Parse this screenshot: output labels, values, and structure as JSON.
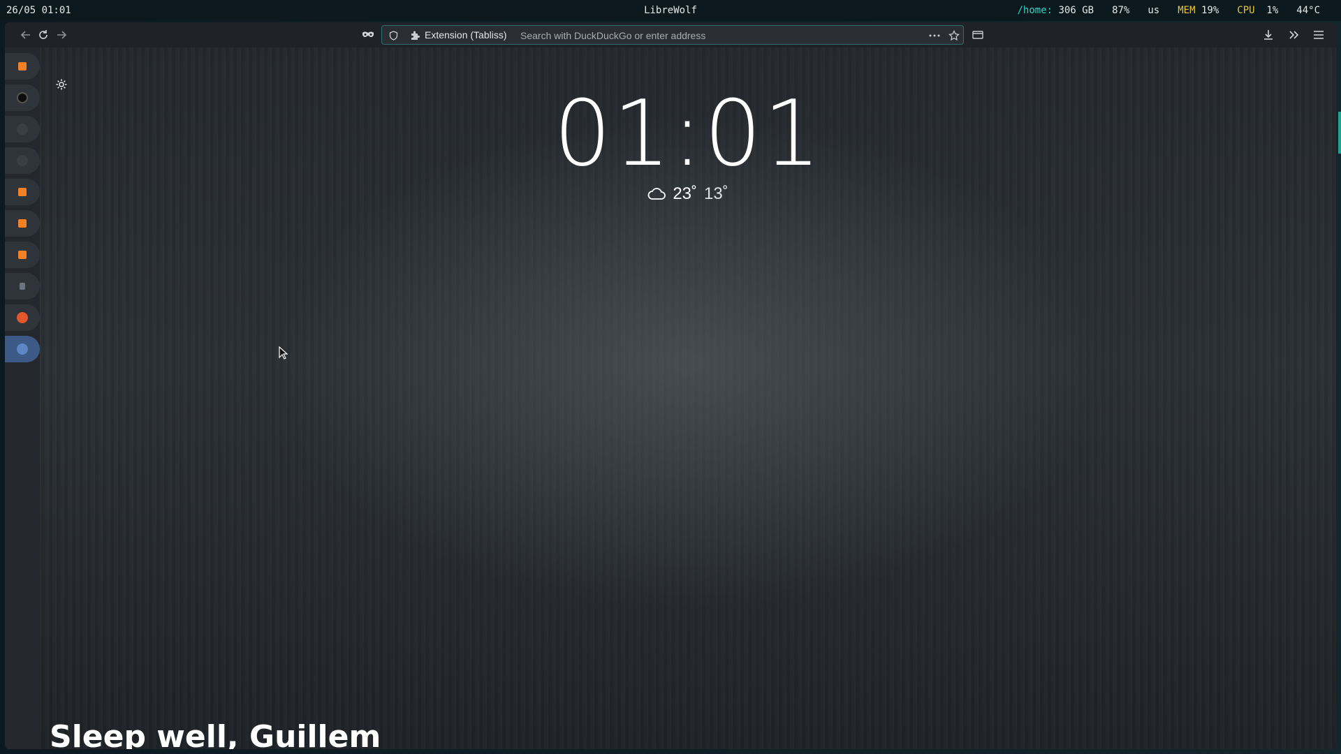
{
  "statusbar": {
    "datetime": "26/05 01:01",
    "window_title": "LibreWolf",
    "home_label": "/home:",
    "home_value": "306 GB",
    "volume": "87%",
    "keyboard_layout": "us",
    "mem_label": "MEM",
    "mem_value": "19%",
    "cpu_label": "CPU",
    "cpu_value": "1%",
    "temperature": "44°C"
  },
  "toolbar": {
    "url_extension_label": "Extension (Tabliss)",
    "url_placeholder": "Search with DuckDuckGo or enter address",
    "url_value": ""
  },
  "sidebar": {
    "items": [
      {
        "name": "stackoverflow-1",
        "color": "#f48024"
      },
      {
        "name": "site-dark-1",
        "color": "#111111"
      },
      {
        "name": "github-1",
        "color": "#3a3f46"
      },
      {
        "name": "github-2",
        "color": "#3a3f46"
      },
      {
        "name": "stackoverflow-2",
        "color": "#f48024"
      },
      {
        "name": "stackoverflow-3",
        "color": "#f48024"
      },
      {
        "name": "stackoverflow-4",
        "color": "#f48024"
      },
      {
        "name": "site-small",
        "color": "#6b7280"
      },
      {
        "name": "ask-site",
        "color": "#e4572e"
      },
      {
        "name": "current-tab",
        "color": "#5f86c4"
      }
    ]
  },
  "newtab": {
    "time": "01:01",
    "weather_high": "23˚",
    "weather_low": "13˚",
    "greeting": "Sleep well, Guillem"
  },
  "colors": {
    "accent_teal": "#2fd3c6",
    "accent_yellow": "#e9c83a",
    "active_sidebar": "#3d5a86"
  }
}
